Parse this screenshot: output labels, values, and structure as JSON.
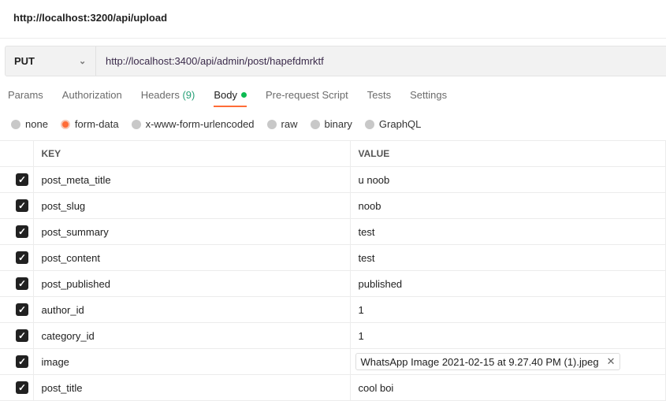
{
  "title": "http://localhost:3200/api/upload",
  "request": {
    "method": "PUT",
    "url": "http://localhost:3400/api/admin/post/hapefdmrktf"
  },
  "tabs": [
    {
      "label": "Params"
    },
    {
      "label": "Authorization"
    },
    {
      "label": "Headers",
      "count": "(9)"
    },
    {
      "label": "Body",
      "active": true
    },
    {
      "label": "Pre-request Script"
    },
    {
      "label": "Tests"
    },
    {
      "label": "Settings"
    }
  ],
  "body_types": [
    {
      "label": "none"
    },
    {
      "label": "form-data",
      "selected": true
    },
    {
      "label": "x-www-form-urlencoded"
    },
    {
      "label": "raw"
    },
    {
      "label": "binary"
    },
    {
      "label": "GraphQL"
    }
  ],
  "table": {
    "headers": [
      "KEY",
      "VALUE"
    ],
    "rows": [
      {
        "key": "post_meta_title",
        "value": "u noob",
        "checked": true
      },
      {
        "key": "post_slug",
        "value": "noob",
        "checked": true
      },
      {
        "key": "post_summary",
        "value": "test",
        "checked": true
      },
      {
        "key": "post_content",
        "value": "test",
        "checked": true
      },
      {
        "key": "post_published",
        "value": "published",
        "checked": true
      },
      {
        "key": "author_id",
        "value": "1",
        "checked": true
      },
      {
        "key": "category_id",
        "value": "1",
        "checked": true
      },
      {
        "key": "image",
        "value": "WhatsApp Image 2021-02-15 at 9.27.40 PM (1).jpeg",
        "checked": true,
        "file": true
      },
      {
        "key": "post_title",
        "value": "cool boi",
        "checked": true
      }
    ]
  },
  "colors": {
    "accent": "#ff6c37",
    "body_dot": "#0cbb52"
  }
}
